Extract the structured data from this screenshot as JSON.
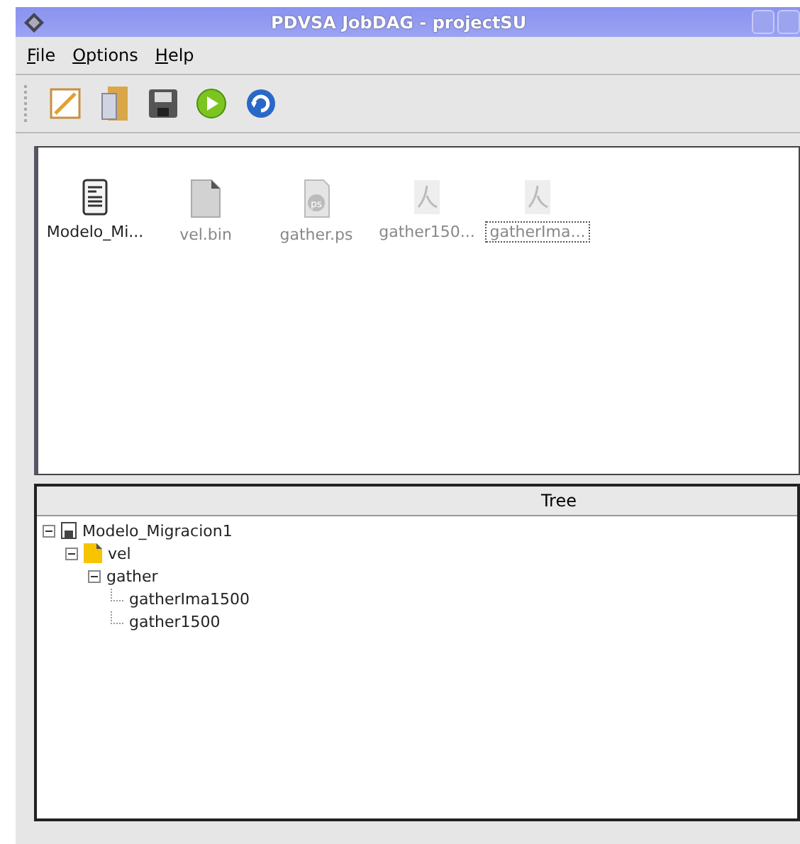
{
  "window": {
    "title": "PDVSA JobDAG - projectSU"
  },
  "menu": [
    {
      "label": "File"
    },
    {
      "label": "Options"
    },
    {
      "label": "Help"
    }
  ],
  "toolbar": [
    {
      "kind": "new"
    },
    {
      "kind": "open"
    },
    {
      "kind": "save"
    },
    {
      "kind": "run"
    },
    {
      "kind": "refresh"
    }
  ],
  "files": [
    {
      "name": "Modelo_Mi...",
      "kind": "doc",
      "selected": false
    },
    {
      "name": "vel.bin",
      "kind": "bin",
      "selected": false
    },
    {
      "name": "gather.ps",
      "kind": "ps",
      "selected": false
    },
    {
      "name": "gather150...",
      "kind": "pdf",
      "selected": false
    },
    {
      "name": "gatherIma...",
      "kind": "pdf",
      "selected": true
    }
  ],
  "tree": {
    "header": "Tree",
    "nodes": [
      {
        "label": "Modelo_Migracion1",
        "kind": "disk",
        "expanded": true,
        "children": [
          {
            "label": "vel",
            "kind": "folder",
            "expanded": true,
            "children": [
              {
                "label": "gather",
                "expanded": true,
                "children": [
                  {
                    "label": "gatherIma1500"
                  },
                  {
                    "label": "gather1500"
                  }
                ]
              }
            ]
          }
        ]
      }
    ]
  }
}
